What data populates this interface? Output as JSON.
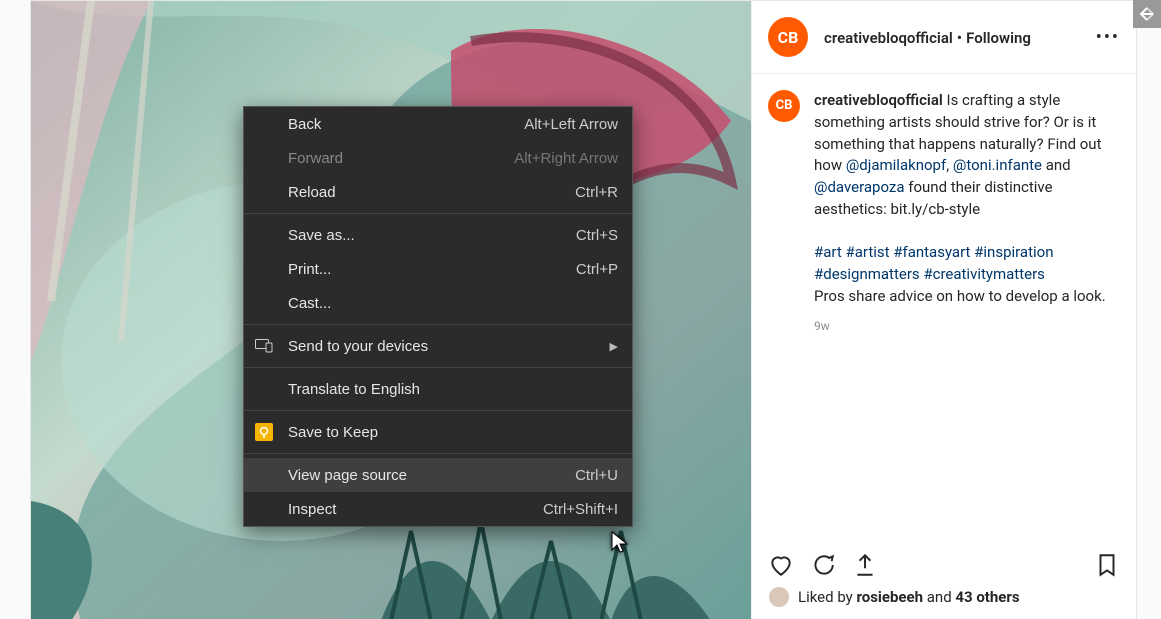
{
  "account": {
    "username": "creativebloqofficial",
    "avatar_text": "CB",
    "separator": "•",
    "follow_state": "Following",
    "more_label": "•••"
  },
  "caption": {
    "username": "creativebloqofficial",
    "text_before_mentions": "Is crafting a style something artists should strive for? Or is it something that happens naturally? Find out how ",
    "mention1": "@djamilaknopf",
    "comma1": ", ",
    "mention2": "@toni.infante",
    "and": " and ",
    "mention3": "@daverapoza",
    "text_after_mentions": " found their distinctive aesthetics: bit.ly/cb-style",
    "hashtags": "#art #artist #fantasyart #inspiration #designmatters #creativitymatters",
    "trailing": "Pros share advice on how to develop a look.",
    "timestamp": "9w"
  },
  "likes": {
    "prefix": "Liked by ",
    "user": "rosiebeeh",
    "and": " and ",
    "others": "43 others"
  },
  "context_menu": {
    "back": {
      "label": "Back",
      "shortcut": "Alt+Left Arrow"
    },
    "forward": {
      "label": "Forward",
      "shortcut": "Alt+Right Arrow"
    },
    "reload": {
      "label": "Reload",
      "shortcut": "Ctrl+R"
    },
    "save_as": {
      "label": "Save as...",
      "shortcut": "Ctrl+S"
    },
    "print": {
      "label": "Print...",
      "shortcut": "Ctrl+P"
    },
    "cast": {
      "label": "Cast..."
    },
    "send_devices": {
      "label": "Send to your devices"
    },
    "translate": {
      "label": "Translate to English"
    },
    "save_keep": {
      "label": "Save to Keep"
    },
    "view_source": {
      "label": "View page source",
      "shortcut": "Ctrl+U"
    },
    "inspect": {
      "label": "Inspect",
      "shortcut": "Ctrl+Shift+I"
    }
  }
}
